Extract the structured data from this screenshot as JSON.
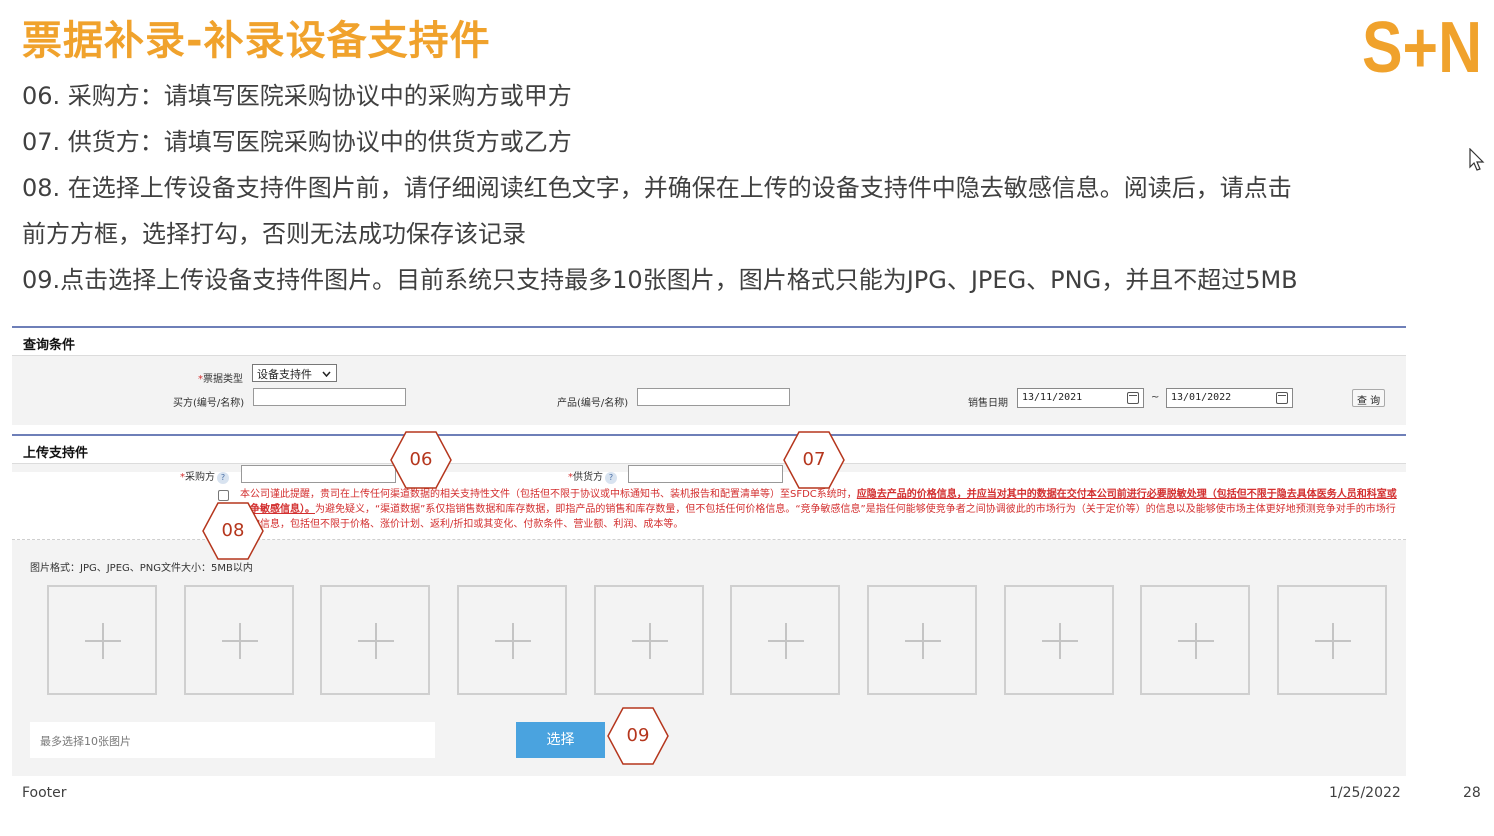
{
  "slide": {
    "title": "票据补录-补录设备支持件",
    "logo_text": "S+N",
    "accent_color": "#f0a22c",
    "instructions": [
      "06. 采购方：请填写医院采购协议中的采购方或甲方",
      "07. 供货方：请填写医院采购协议中的供货方或乙方",
      "08. 在选择上传设备支持件图片前，请仔细阅读红色文字，并确保在上传的设备支持件中隐去敏感信息。阅读后，请点击",
      "前方方框，选择打勾，否则无法成功保存该记录",
      "09.点击选择上传设备支持件图片。目前系统只支持最多10张图片，图片格式只能为JPG、JPEG、PNG，并且不超过5MB"
    ]
  },
  "query_panel": {
    "title": "查询条件",
    "ticket_type_label": "票据类型",
    "ticket_type_value": "设备支持件",
    "buyer_label": "买方(编号/名称)",
    "buyer_value": "",
    "product_label": "产品(编号/名称)",
    "product_value": "",
    "sale_date_label": "销售日期",
    "date_from": "13/11/2021",
    "date_separator": "~",
    "date_to": "13/01/2022",
    "query_button": "查 询"
  },
  "upload_panel": {
    "title": "上传支持件",
    "purchaser_label": "采购方",
    "purchaser_value": "",
    "supplier_label": "供货方",
    "supplier_value": "",
    "help_glyph": "?",
    "notice_part1": "本公司谨此提醒，贵司在上传任何渠道数据的相关支持性文件（包括但不限于协议或中标通知书、装机报告和配置清单等）至SFDC系统时，",
    "notice_bold": "应隐去产品的价格信息，并应当对其中的数据在交付本公司前进行必要脱敏处理（包括但不限于隐去具体医务人员和科室或竞争敏感信息）。",
    "notice_part2": "为避免疑义，“渠道数据”系仅指销售数据和库存数据，即指产品的销售和库存数量，但不包括任何价格信息。“竞争敏感信息”是指任何能够使竞争者之间协调彼此的市场行为（关于定价等）的信息以及能够使市场主体更好地预测竞争对手的市场行为的信息，包括但不限于价格、涨价计划、返利/折扣或其变化、付款条件、营业额、利润、成本等。",
    "format_hint": "图片格式：JPG、JPEG、PNG文件大小：5MB以内",
    "slot_count": 10,
    "picker_placeholder": "最多选择10张图片",
    "select_button": "选择",
    "button_color": "#4aa3df"
  },
  "markers": [
    "06",
    "07",
    "08",
    "09"
  ],
  "marker_color": "#b5361d",
  "footer": {
    "label": "Footer",
    "date": "1/25/2022",
    "page": "28"
  }
}
